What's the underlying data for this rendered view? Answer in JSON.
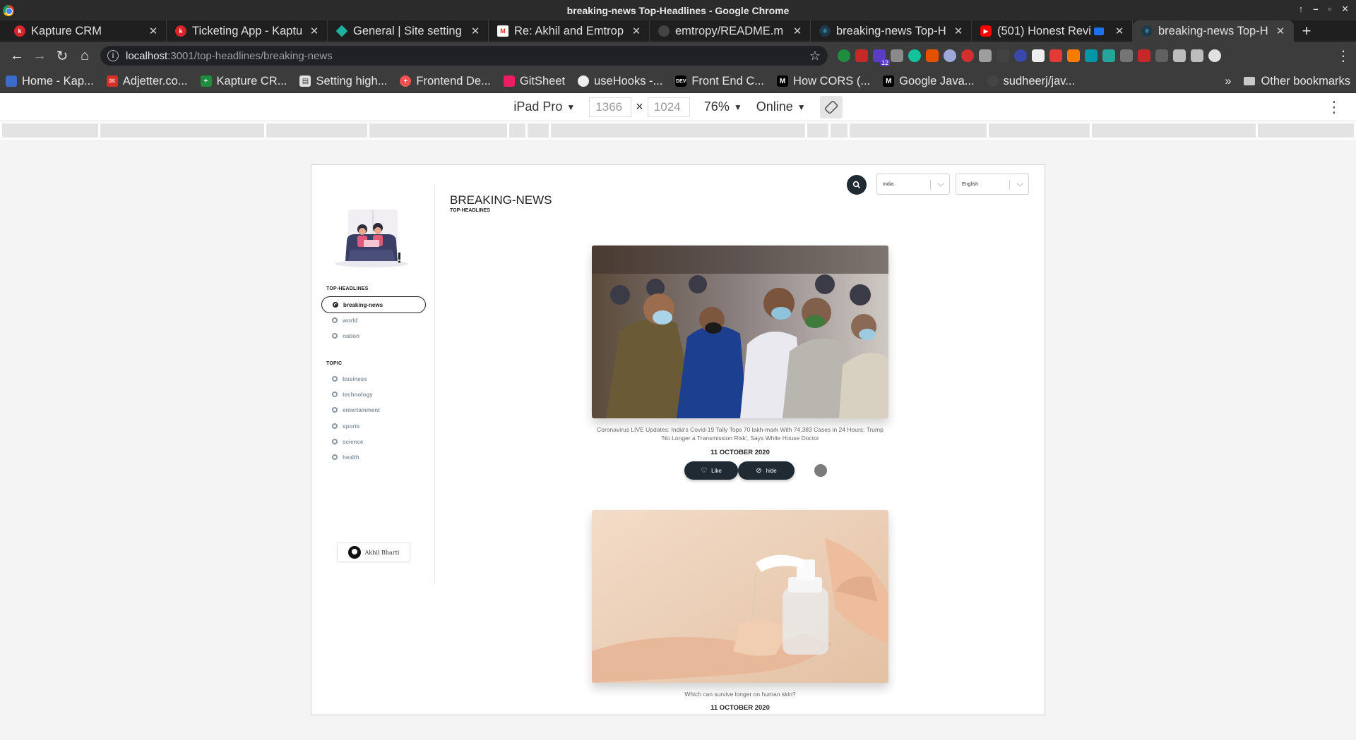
{
  "window": {
    "title": "breaking-news Top-Headlines - Google Chrome"
  },
  "tabs": [
    {
      "label": "Kapture CRM",
      "icon": "kapture-icon",
      "color": "#d9252a"
    },
    {
      "label": "Ticketing App - Kaptu",
      "icon": "kapture-icon",
      "color": "#d9252a"
    },
    {
      "label": "General | Site setting",
      "icon": "netlify-icon",
      "color": "#20b2a0"
    },
    {
      "label": "Re: Akhil and Emtrop",
      "icon": "gmail-icon",
      "color": "#d93025"
    },
    {
      "label": "emtropy/README.m",
      "icon": "github-icon",
      "color": "#444444"
    },
    {
      "label": "breaking-news Top-H",
      "icon": "react-icon",
      "color": "#61dafb"
    },
    {
      "label": "(501) Honest Revi",
      "icon": "youtube-icon",
      "color": "#ff0000"
    },
    {
      "label": "breaking-news Top-H",
      "icon": "react-icon",
      "color": "#61dafb",
      "active": true
    }
  ],
  "toolbar": {
    "url_host": "localhost",
    "url_path": ":3001/top-headlines/breaking-news"
  },
  "extensions": {
    "badge_count": "12"
  },
  "bookmarks": [
    {
      "label": "Home - Kap...",
      "icon": "kapture-icon",
      "color": "#3b6cc9"
    },
    {
      "label": "Adjetter.co...",
      "icon": "mail-icon",
      "color": "#d93025"
    },
    {
      "label": "Kapture CR...",
      "icon": "plus-icon",
      "color": "#1e8e3e"
    },
    {
      "label": "Setting high...",
      "icon": "doc-icon",
      "color": "#e0e0e0"
    },
    {
      "label": "Frontend De...",
      "icon": "plus-circle-icon",
      "color": "#ef5350"
    },
    {
      "label": "GitSheet",
      "icon": "gitsheet-icon",
      "color": "#e91e63"
    },
    {
      "label": "useHooks -...",
      "icon": "hooks-icon",
      "color": "#eeeeee"
    },
    {
      "label": "Front End C...",
      "icon": "dev-icon",
      "color": "#000000"
    },
    {
      "label": "How CORS (...",
      "icon": "medium-icon",
      "color": "#000000"
    },
    {
      "label": "Google Java...",
      "icon": "medium-icon",
      "color": "#000000"
    },
    {
      "label": "sudheerj/jav...",
      "icon": "github-icon",
      "color": "#444444"
    }
  ],
  "bookmarks_more": "»",
  "other_bookmarks": "Other bookmarks",
  "device_toolbar": {
    "device": "iPad Pro",
    "width": "1366",
    "times": "×",
    "height": "1024",
    "zoom": "76%",
    "network": "Online"
  },
  "app": {
    "sections": {
      "top_headlines": "TOP-HEADLINES",
      "topic": "TOPIC"
    },
    "headline_items": [
      "breaking-news",
      "world",
      "nation"
    ],
    "topic_items": [
      "business",
      "technology",
      "entertainment",
      "sports",
      "science",
      "health"
    ],
    "active_item": "breaking-news",
    "github_button": "Akhil Bharti",
    "country_select": "India",
    "language_select": "English",
    "page_title": "BREAKING-NEWS",
    "page_subtitle": "TOP-HEADLINES",
    "articles": [
      {
        "caption": "Coronavirus LIVE Updates: India's Covid-19 Tally Tops 70 lakh-mark With 74,383 Cases in 24 Hours; Trump 'No Longer a Transmission Risk', Says White House Doctor",
        "date": "11 OCTOBER 2020",
        "like": "Like",
        "hide": "hide"
      },
      {
        "caption": "Which can survive longer on human skin?",
        "date": "11 OCTOBER 2020"
      }
    ]
  }
}
